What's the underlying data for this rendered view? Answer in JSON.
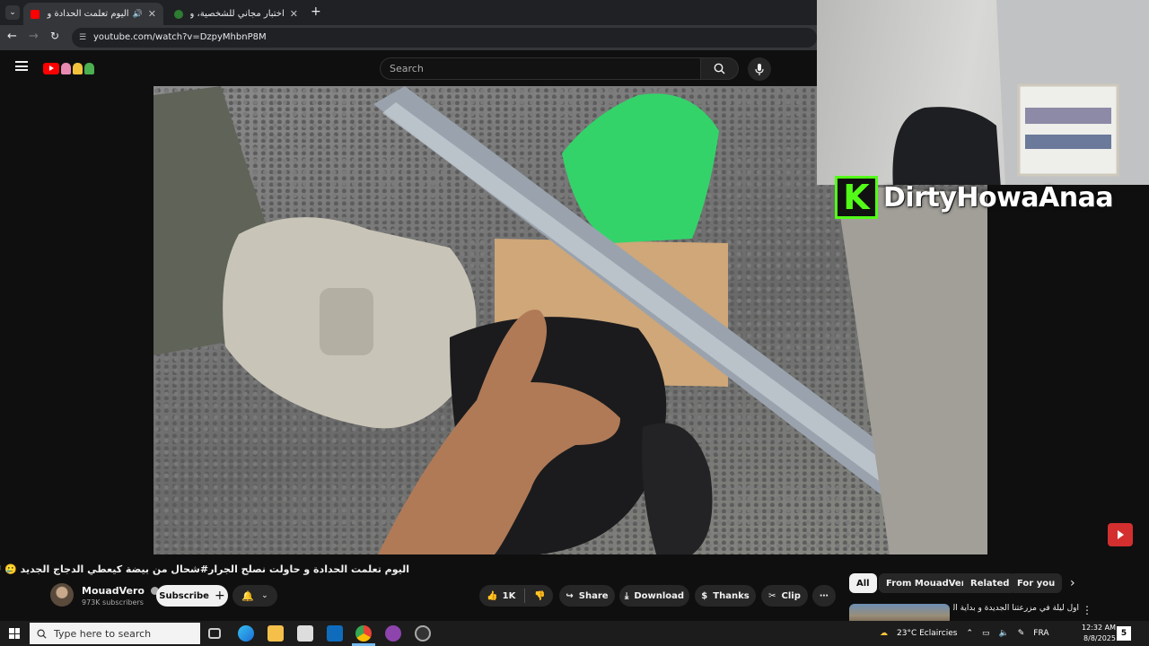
{
  "browser": {
    "tabs": [
      {
        "label": "اليوم تعلمت الحدادة و حاولت",
        "active": true,
        "audio": true
      },
      {
        "label": "اختبار مجاني للشخصية، وأوصاف",
        "active": false
      }
    ],
    "url": "youtube.com/watch?v=DzpyMhbnP8M"
  },
  "youtube": {
    "search_placeholder": "Search",
    "video": {
      "title": "اليوم تعلمت الحدادة و حاولت نصلح الجرار#شحال من بيضة كيعطي الدجاج الجديد 🥲 MARU",
      "channel": "MouadVero",
      "subscribers": "973K subscribers",
      "subscribe_label": "Subscribe",
      "likes": "1K",
      "share_label": "Share",
      "download_label": "Download",
      "thanks_label": "Thanks",
      "clip_label": "Clip"
    },
    "chips": [
      "All",
      "From MouadVero",
      "Related",
      "For you"
    ],
    "recommendation": {
      "title": "أول ليلة في مزرعتنا الجديدة و بداية الرحيل"
    }
  },
  "overlay": {
    "streamer_name": "DirtyHowaAnaa",
    "platform_letter": "K"
  },
  "taskbar": {
    "search_placeholder": "Type here to search",
    "weather": "23°C  Eclaircies",
    "language": "FRA",
    "time": "12:32 AM",
    "date": "8/8/2025"
  },
  "colors": {
    "kick_green": "#53fc18",
    "youtube_red": "#ff0000",
    "background": "#0f0f0f"
  }
}
